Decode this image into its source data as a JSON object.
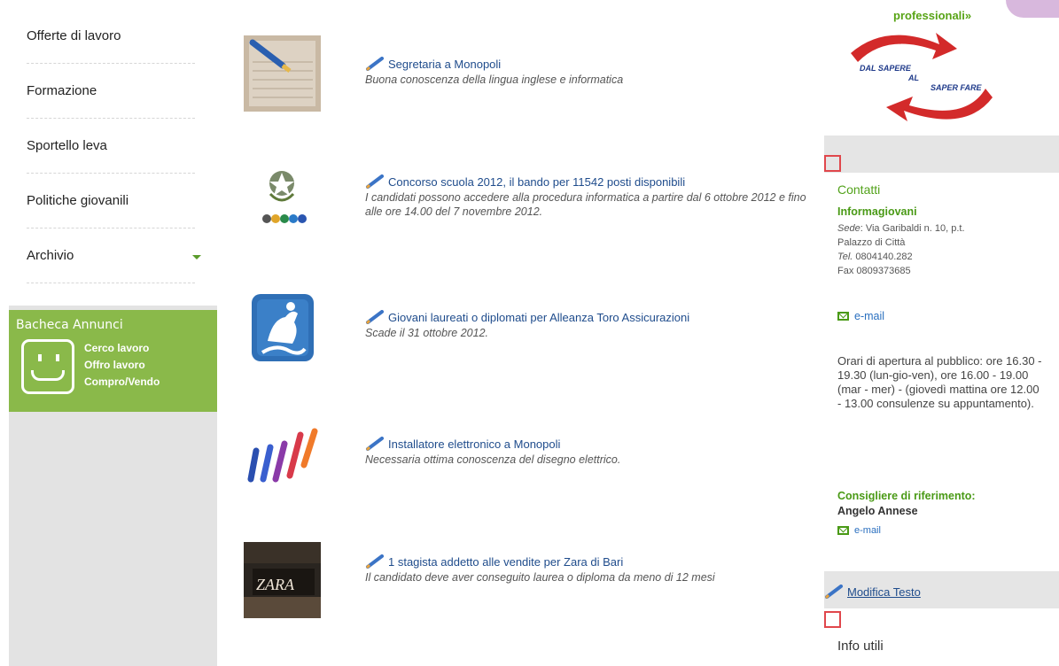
{
  "nav": {
    "items": [
      {
        "label": "Offerte di lavoro"
      },
      {
        "label": "Formazione"
      },
      {
        "label": "Sportello leva"
      },
      {
        "label": "Politiche giovanili"
      },
      {
        "label": "Archivio"
      }
    ]
  },
  "bacheca": {
    "title": "Bacheca Annunci",
    "links": [
      "Cerco lavoro",
      "Offro lavoro",
      "Compro/Vendo"
    ]
  },
  "listings": [
    {
      "title": "Segretaria a Monopoli",
      "desc": "Buona conoscenza della lingua inglese e informatica",
      "thumb_icon": "document-pen-thumb"
    },
    {
      "title": "Concorso scuola 2012, il bando per 11542 posti disponibili",
      "desc": "I candidati possono accedere alla procedura informatica a partire dal 6 ottobre 2012 e fino alle ore 14.00 del 7 novembre 2012.",
      "thumb_icon": "italian-emblem-thumb"
    },
    {
      "title": "Giovani laureati o diplomati per Alleanza Toro Assicurazioni",
      "desc": "Scade il 31 ottobre 2012.",
      "thumb_icon": "horse-rider-thumb"
    },
    {
      "title": "Installatore elettronico a Monopoli",
      "desc": "Necessaria ottima conoscenza del disegno elettrico.",
      "thumb_icon": "color-stripes-thumb"
    },
    {
      "title": "1 stagista addetto alle vendite per Zara di Bari",
      "desc": "Il candidato deve aver conseguito laurea o diploma da meno di 12 mesi",
      "thumb_icon": "zara-store-thumb"
    }
  ],
  "right": {
    "professionali": "professionali»",
    "logo_text": [
      "DAL SAPERE",
      "AL",
      "SAPER FARE"
    ],
    "contatti": "Contatti",
    "info_title": "Informagiovani",
    "addr": {
      "sede_label": "Sede",
      "sede_value": ": Via Garibaldi n. 10, p.t.",
      "line2": "Palazzo di Città",
      "tel_label": "Tel.",
      "tel_value": " 0804140.282",
      "fax": "Fax 0809373685"
    },
    "email_label": "e-mail",
    "orari": "Orari di apertura al pubblico: ore 16.30 - 19.30 (lun-gio-ven), ore 16.00 - 19.00 (mar - mer) - (giovedì mattina ore 12.00 - 13.00 consulenze su appuntamento).",
    "consigliere_label": "Consigliere di riferimento:",
    "consigliere_name": "Angelo Annese",
    "consigliere_email": "e-mail",
    "modifica": "Modifica Testo",
    "info_utili": "Info utili"
  },
  "colors": {
    "accent_green": "#8ab94a",
    "link_blue": "#1f4c8c",
    "marker_red": "#e0474c"
  }
}
